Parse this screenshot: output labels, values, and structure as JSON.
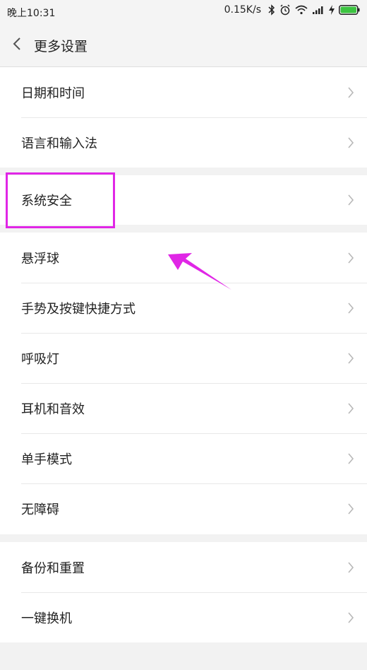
{
  "status": {
    "time": "晚上10:31",
    "speed": "0.15K/s",
    "icons": [
      "bluetooth-icon",
      "alarm-icon",
      "wifi-icon",
      "signal-icon",
      "charging-icon",
      "battery-icon"
    ]
  },
  "header": {
    "back_icon": "chevron-left-icon",
    "title": "更多设置"
  },
  "groups": [
    {
      "items": [
        {
          "label": "日期和时间"
        },
        {
          "label": "语言和输入法"
        }
      ]
    },
    {
      "items": [
        {
          "label": "系统安全"
        }
      ]
    },
    {
      "items": [
        {
          "label": "悬浮球"
        },
        {
          "label": "手势及按键快捷方式"
        },
        {
          "label": "呼吸灯"
        },
        {
          "label": "耳机和音效"
        },
        {
          "label": "单手模式"
        },
        {
          "label": "无障碍"
        }
      ]
    },
    {
      "items": [
        {
          "label": "备份和重置"
        },
        {
          "label": "一键换机"
        }
      ]
    }
  ],
  "annotation": {
    "highlight_color": "#e026e6",
    "arrow_color": "#e026e6"
  },
  "colors": {
    "background": "#f2f2f2",
    "battery": "#3cc441"
  }
}
